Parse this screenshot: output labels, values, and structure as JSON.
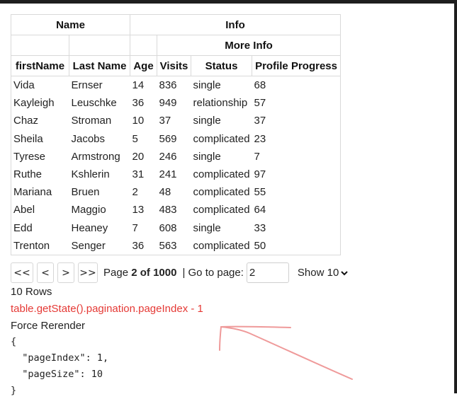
{
  "table": {
    "group_headers": [
      "Name",
      "Info"
    ],
    "subgroup_headers": [
      "More Info"
    ],
    "columns": [
      "firstName",
      "Last Name",
      "Age",
      "Visits",
      "Status",
      "Profile Progress"
    ],
    "rows": [
      [
        "Vida",
        "Ernser",
        "14",
        "836",
        "single",
        "68"
      ],
      [
        "Kayleigh",
        "Leuschke",
        "36",
        "949",
        "relationship",
        "57"
      ],
      [
        "Chaz",
        "Stroman",
        "10",
        "37",
        "single",
        "37"
      ],
      [
        "Sheila",
        "Jacobs",
        "5",
        "569",
        "complicated",
        "23"
      ],
      [
        "Tyrese",
        "Armstrong",
        "20",
        "246",
        "single",
        "7"
      ],
      [
        "Ruthe",
        "Kshlerin",
        "31",
        "241",
        "complicated",
        "97"
      ],
      [
        "Mariana",
        "Bruen",
        "2",
        "48",
        "complicated",
        "55"
      ],
      [
        "Abel",
        "Maggio",
        "13",
        "483",
        "complicated",
        "64"
      ],
      [
        "Edd",
        "Heaney",
        "7",
        "608",
        "single",
        "33"
      ],
      [
        "Trenton",
        "Senger",
        "36",
        "563",
        "complicated",
        "50"
      ]
    ]
  },
  "pagination": {
    "first_label": "<<",
    "prev_label": "<",
    "next_label": ">",
    "last_label": ">>",
    "page_label": "Page",
    "page_current": "2",
    "page_of": "of",
    "page_total": "1000",
    "goto_label": "| Go to page:",
    "goto_value": "2",
    "show_label": "Show 10"
  },
  "rows_count": "10 Rows",
  "page_index_expr": "table.getState().pagination.pageIndex - 1",
  "force_rerender": "Force Rerender",
  "state_json": "{\n  \"pageIndex\": 1,\n  \"pageSize\": 10\n}",
  "colors": {
    "accent_red": "#e53935",
    "annotation_pink": "#ef9a9a",
    "frame": "#1e1e1e"
  }
}
